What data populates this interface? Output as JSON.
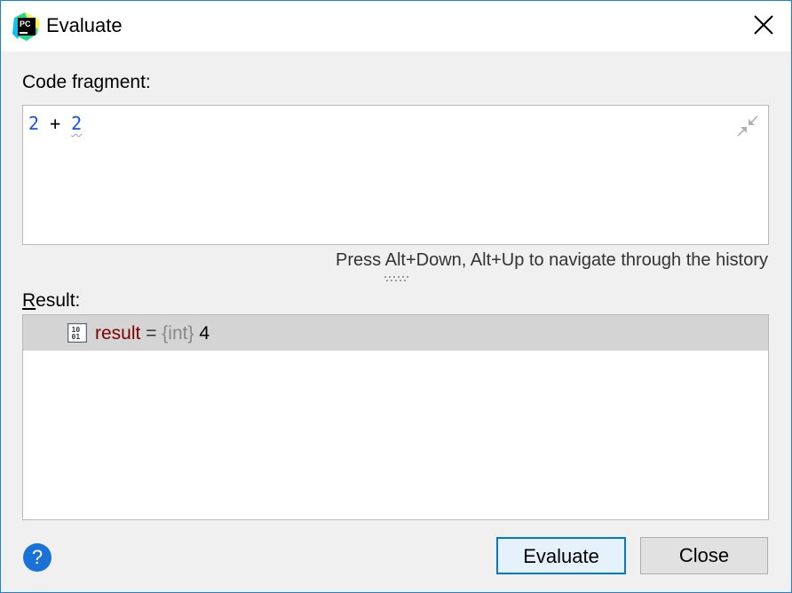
{
  "window": {
    "title": "Evaluate",
    "app_icon_text": "PC"
  },
  "code": {
    "label": "Code fragment:",
    "expression": {
      "left": "2",
      "operator": " + ",
      "right": "2"
    }
  },
  "hint": "Press Alt+Down, Alt+Up to navigate through the history",
  "result": {
    "label_mnemonic": "R",
    "label_rest": "esult:",
    "rows": [
      {
        "name": "result",
        "equals": " = ",
        "type": "{int}",
        "value": " 4"
      }
    ]
  },
  "buttons": {
    "help": "?",
    "evaluate": "Evaluate",
    "close": "Close"
  },
  "colors": {
    "accent": "#0078d7",
    "number": "#1750eb",
    "variable": "#800000",
    "type": "#888888",
    "selection": "#d4d4d4"
  }
}
